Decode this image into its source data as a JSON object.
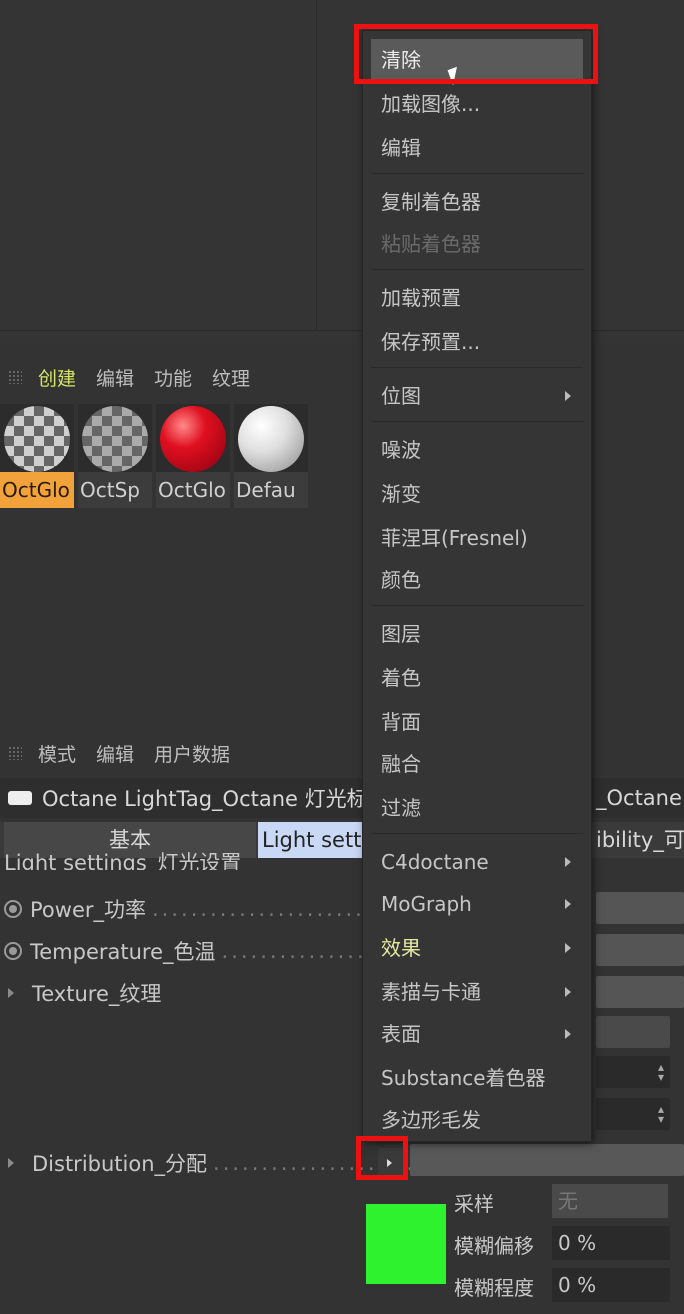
{
  "material_manager": {
    "menu": [
      "创建",
      "编辑",
      "功能",
      "纹理"
    ],
    "materials": [
      {
        "label": "OctGlo",
        "selected": true
      },
      {
        "label": "OctSp",
        "selected": false
      },
      {
        "label": "OctGlo",
        "selected": false
      },
      {
        "label": "Defau",
        "selected": false
      }
    ]
  },
  "attribute_manager": {
    "menu": [
      "模式",
      "编辑",
      "用户数据"
    ],
    "object_name": "Octane LightTag_Octane 灯光标签",
    "object_name_right": "_Octane",
    "tabs": {
      "basic": "基本",
      "light": "Light setti",
      "visibility": "ibility_可"
    },
    "section_title": "Light settings_灯光设置",
    "props": {
      "power": "Power_功率",
      "temperature": "Temperature_色温",
      "texture": "Texture_纹理",
      "distribution": "Distribution_分配"
    },
    "dots": ".........................",
    "sampling_label": "采样",
    "sampling_value": "无",
    "blur_offset_label": "模糊偏移",
    "blur_offset_value": "0 %",
    "blur_amount_label": "模糊程度",
    "blur_amount_value": "0 %",
    "swatch_color": "#2ef22e"
  },
  "context_menu": {
    "items": {
      "clear": "清除",
      "load_image": "加载图像...",
      "edit": "编辑",
      "copy_shader": "复制着色器",
      "paste_shader": "粘贴着色器",
      "load_preset": "加载预置",
      "save_preset": "保存预置...",
      "bitmap": "位图",
      "noise": "噪波",
      "gradient": "渐变",
      "fresnel": "菲涅耳(Fresnel)",
      "color": "颜色",
      "layer": "图层",
      "colorizer": "着色",
      "backface": "背面",
      "fusion": "融合",
      "filter": "过滤",
      "c4doctane": "C4doctane",
      "mograph": "MoGraph",
      "effects": "效果",
      "sketch_toon": "素描与卡通",
      "surfaces": "表面",
      "substance": "Substance着色器",
      "hair": "多边形毛发"
    }
  }
}
